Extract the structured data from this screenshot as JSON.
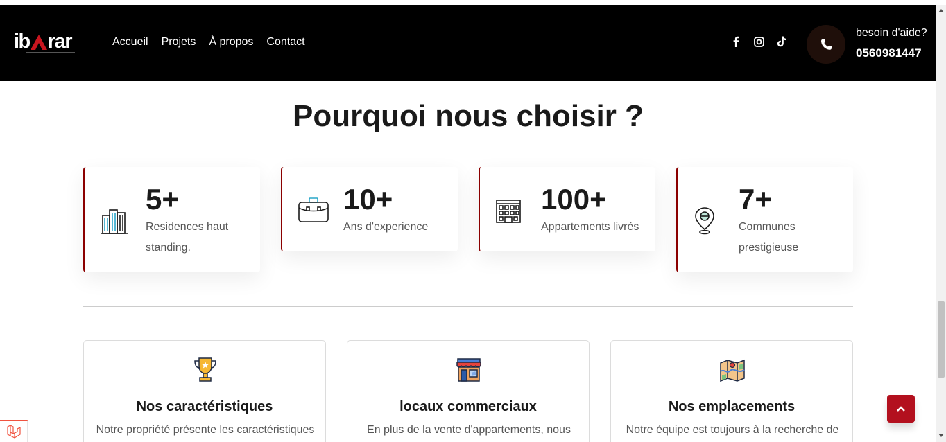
{
  "brand": {
    "logo_text_left": "ib",
    "logo_text_right": "rar",
    "accent_color": "#b3101e"
  },
  "nav": {
    "items": [
      {
        "label": "Accueil"
      },
      {
        "label": "Projets"
      },
      {
        "label": "À propos"
      },
      {
        "label": "Contact"
      }
    ],
    "socials": [
      "facebook-icon",
      "instagram-icon",
      "tiktok-icon"
    ],
    "help": {
      "label": "besoin d'aide?",
      "phone": "0560981447"
    }
  },
  "why": {
    "title": "Pourquoi nous choisir ?",
    "stats": [
      {
        "value": "5+",
        "label": "Residences haut standing.",
        "icon": "buildings-icon"
      },
      {
        "value": "10+",
        "label": "Ans d'experience",
        "icon": "briefcase-icon"
      },
      {
        "value": "100+",
        "label": "Appartements livrés",
        "icon": "apartment-building-icon"
      },
      {
        "value": "7+",
        "label": "Communes prestigieuse",
        "icon": "location-pin-icon"
      }
    ]
  },
  "features": [
    {
      "title": "Nos caractéristiques",
      "text": "Notre propriété présente les caractéristiques",
      "icon": "trophy-icon"
    },
    {
      "title": "locaux commerciaux",
      "text": "En plus de la vente d'appartements, nous",
      "icon": "shop-icon"
    },
    {
      "title": "Nos emplacements",
      "text": "Notre équipe est toujours à la recherche de",
      "icon": "map-icon"
    }
  ]
}
